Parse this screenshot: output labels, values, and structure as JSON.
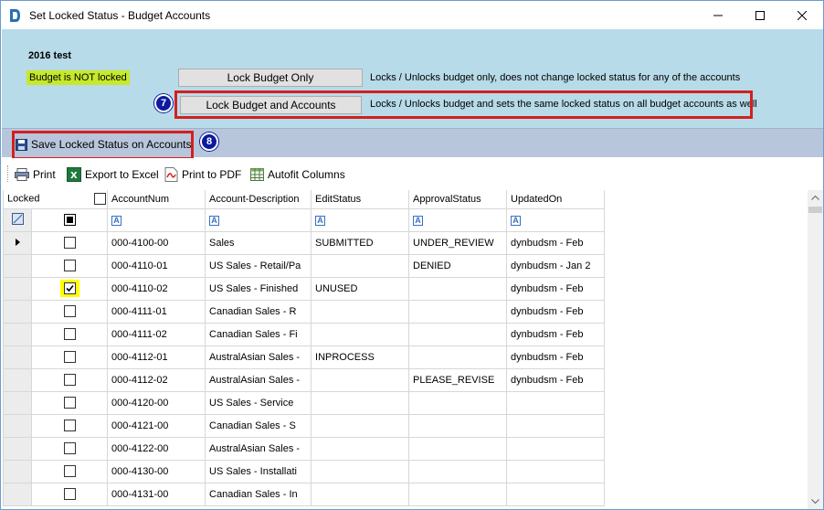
{
  "window": {
    "title": "Set Locked Status - Budget Accounts",
    "minimize_icon": "minimize-icon",
    "maximize_icon": "maximize-icon",
    "close_icon": "close-icon"
  },
  "header": {
    "budget_name": "2016 test",
    "lock_status": "Budget is NOT locked",
    "lock_status_color": "#c6e92a",
    "lock_budget_only_label": "Lock Budget Only",
    "lock_budget_only_desc": "Locks / Unlocks budget only, does not change locked status for any of the accounts",
    "lock_budget_accounts_label": "Lock Budget and Accounts",
    "lock_budget_accounts_desc": "Locks / Unlocks budget and sets the same locked status on all budget accounts as well",
    "callout_7": "7"
  },
  "save_bar": {
    "save_label": "Save Locked Status on Accounts",
    "callout_8": "8"
  },
  "toolbar": {
    "print_label": "Print",
    "export_excel_label": "Export to Excel",
    "print_pdf_label": "Print to PDF",
    "autofit_label": "Autofit Columns"
  },
  "grid": {
    "columns": [
      "Locked",
      "AccountNum",
      "Account-Description",
      "EditStatus",
      "ApprovalStatus",
      "UpdatedOn"
    ],
    "rows": [
      {
        "locked": false,
        "current": true,
        "account": "000-4100-00",
        "description": "Sales",
        "edit": "SUBMITTED",
        "approval": "UNDER_REVIEW",
        "updated": "dynbudsm - Feb"
      },
      {
        "locked": false,
        "current": false,
        "account": "000-4110-01",
        "description": "US Sales - Retail/Pa",
        "edit": "",
        "approval": "DENIED",
        "updated": "dynbudsm - Jan 2"
      },
      {
        "locked": true,
        "current": false,
        "account": "000-4110-02",
        "description": "US Sales - Finished",
        "edit": "UNUSED",
        "approval": "",
        "updated": "dynbudsm - Feb"
      },
      {
        "locked": false,
        "current": false,
        "account": "000-4111-01",
        "description": "Canadian Sales - R",
        "edit": "",
        "approval": "",
        "updated": "dynbudsm - Feb"
      },
      {
        "locked": false,
        "current": false,
        "account": "000-4111-02",
        "description": "Canadian Sales - Fi",
        "edit": "",
        "approval": "",
        "updated": "dynbudsm - Feb"
      },
      {
        "locked": false,
        "current": false,
        "account": "000-4112-01",
        "description": "AustralAsian Sales -",
        "edit": "INPROCESS",
        "approval": "",
        "updated": "dynbudsm - Feb"
      },
      {
        "locked": false,
        "current": false,
        "account": "000-4112-02",
        "description": "AustralAsian Sales -",
        "edit": "",
        "approval": "PLEASE_REVISE",
        "updated": "dynbudsm - Feb"
      },
      {
        "locked": false,
        "current": false,
        "account": "000-4120-00",
        "description": "US Sales - Service",
        "edit": "",
        "approval": "",
        "updated": ""
      },
      {
        "locked": false,
        "current": false,
        "account": "000-4121-00",
        "description": "Canadian Sales - S",
        "edit": "",
        "approval": "",
        "updated": ""
      },
      {
        "locked": false,
        "current": false,
        "account": "000-4122-00",
        "description": "AustralAsian Sales -",
        "edit": "",
        "approval": "",
        "updated": ""
      },
      {
        "locked": false,
        "current": false,
        "account": "000-4130-00",
        "description": "US Sales - Installati",
        "edit": "",
        "approval": "",
        "updated": ""
      },
      {
        "locked": false,
        "current": false,
        "account": "000-4131-00",
        "description": "Canadian Sales - In",
        "edit": "",
        "approval": "",
        "updated": ""
      }
    ]
  },
  "colors": {
    "header_bg": "#b7dbe8",
    "save_bar_bg": "#b8c6dc",
    "highlight_red": "#d41f1f",
    "callout_blue": "#0b1a9e",
    "checked_highlight": "#ffff00"
  }
}
